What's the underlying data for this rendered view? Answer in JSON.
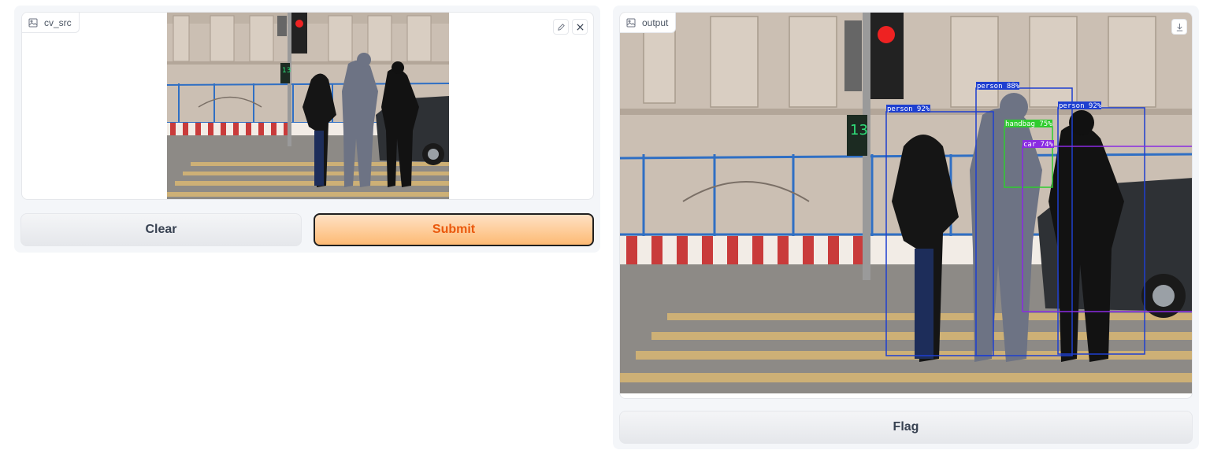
{
  "input_panel": {
    "label": "cv_src",
    "edit_tooltip": "edit-icon",
    "close_tooltip": "close-icon"
  },
  "buttons": {
    "clear": "Clear",
    "submit": "Submit",
    "flag": "Flag"
  },
  "output_panel": {
    "label": "output",
    "detections": [
      {
        "label": "person 92%",
        "color": "#1e3fd0"
      },
      {
        "label": "person 88%",
        "color": "#1e3fd0"
      },
      {
        "label": "person 92%",
        "color": "#1e3fd0"
      },
      {
        "label": "handbag 75%",
        "color": "#2ecc2e"
      },
      {
        "label": "car 74%",
        "color": "#8a2be2"
      }
    ]
  },
  "colors": {
    "accent": "#ea580c",
    "submit_bg": "#fdba74",
    "person_box": "#1e3fd0",
    "handbag_box": "#2ecc2e",
    "car_box": "#8a2be2"
  }
}
